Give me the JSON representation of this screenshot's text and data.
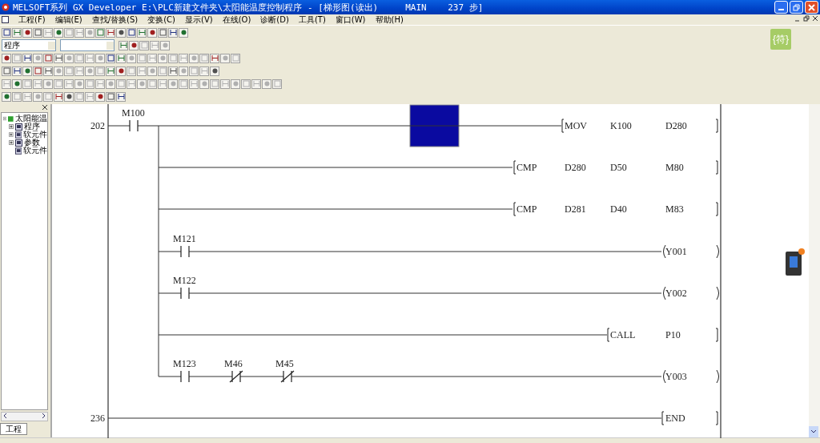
{
  "window": {
    "title": "MELSOFT系列 GX Developer E:\\PLC新建文件夹\\太阳能温度控制程序 - [梯形图(读出)",
    "title_tail": "MAIN    237 步]"
  },
  "menu": [
    "工程(F)",
    "编辑(E)",
    "查找/替换(S)",
    "变换(C)",
    "显示(V)",
    "在线(O)",
    "诊断(D)",
    "工具(T)",
    "窗口(W)",
    "帮助(H)"
  ],
  "toolbars": [
    {
      "disabled": [
        false,
        false,
        false,
        false,
        true,
        false,
        true,
        true,
        true,
        false,
        false,
        false,
        false,
        false,
        false,
        false,
        false,
        false
      ]
    },
    {
      "dropdowns": [
        {
          "kind": "text",
          "value": "程序"
        },
        {
          "kind": "empty"
        }
      ],
      "disabled": [
        false,
        false,
        true,
        true,
        true
      ]
    },
    {
      "disabled": [
        false,
        true,
        false,
        true,
        false,
        false,
        true,
        true,
        true,
        true,
        false,
        false,
        true,
        true,
        true,
        true,
        true,
        true,
        true,
        true,
        false,
        true,
        true
      ]
    },
    {
      "disabled": [
        false,
        false,
        false,
        false,
        false,
        true,
        true,
        true,
        true,
        true,
        false,
        false,
        true,
        true,
        true,
        true,
        false,
        true,
        true,
        true,
        false
      ]
    },
    {
      "disabled": [
        true,
        false,
        true,
        true,
        true,
        true,
        true,
        true,
        true,
        true,
        true,
        true,
        true,
        true,
        true,
        true,
        true,
        true,
        true,
        true,
        true,
        true,
        true,
        true,
        true,
        true,
        true
      ]
    },
    {
      "disabled": [
        false,
        true,
        true,
        true,
        true,
        false,
        false,
        true,
        true,
        false,
        false,
        false
      ]
    }
  ],
  "symbol_button": "{符}",
  "project_tree": {
    "root": "太阳能温",
    "expanded": true,
    "children": [
      {
        "label": "程序",
        "expandable": true
      },
      {
        "label": "软元件",
        "expandable": true
      },
      {
        "label": "参数",
        "expandable": true
      },
      {
        "label": "软元件",
        "expandable": false
      }
    ],
    "tab": "工程"
  },
  "ladder": {
    "rows": [
      {
        "step": "202",
        "items": [
          {
            "kind": "contact_no",
            "device": "M100"
          },
          {
            "kind": "instruction",
            "words": [
              "MOV",
              "K100",
              "D280"
            ]
          }
        ]
      },
      {
        "items": [
          {
            "kind": "instruction",
            "words": [
              "CMP",
              "D280",
              "D50",
              "M80"
            ]
          }
        ]
      },
      {
        "items": [
          {
            "kind": "instruction",
            "words": [
              "CMP",
              "D281",
              "D40",
              "M83"
            ]
          }
        ]
      },
      {
        "items": [
          {
            "kind": "contact_no",
            "device": "M121"
          },
          {
            "kind": "coil",
            "words": [
              "Y001"
            ]
          }
        ]
      },
      {
        "items": [
          {
            "kind": "contact_no",
            "device": "M122"
          },
          {
            "kind": "coil",
            "words": [
              "Y002"
            ]
          }
        ]
      },
      {
        "items": [
          {
            "kind": "instruction",
            "words": [
              "CALL",
              "P10"
            ]
          }
        ]
      },
      {
        "items": [
          {
            "kind": "contact_no",
            "device": "M123"
          },
          {
            "kind": "contact_nc",
            "device": "M46"
          },
          {
            "kind": "contact_nc",
            "device": "M45"
          },
          {
            "kind": "coil",
            "words": [
              "Y003"
            ]
          }
        ]
      },
      {
        "step": "236",
        "items": [
          {
            "kind": "instruction",
            "words": [
              "END"
            ]
          }
        ]
      }
    ]
  }
}
